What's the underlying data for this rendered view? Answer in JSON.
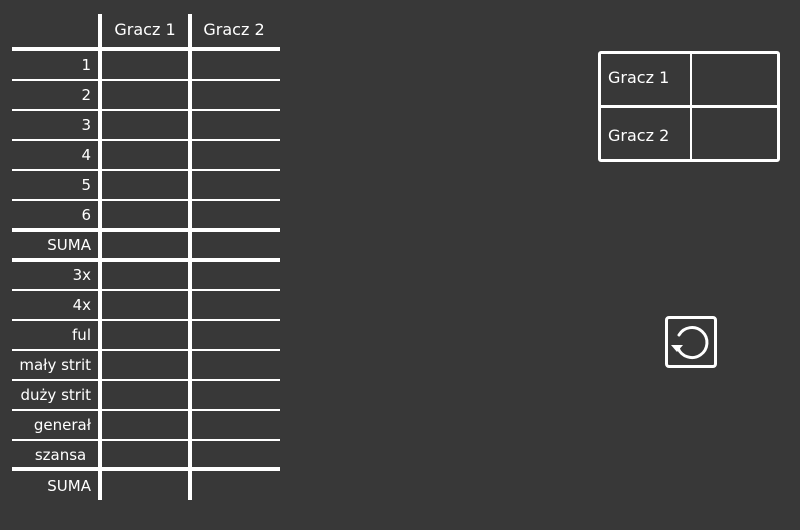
{
  "score_sheet": {
    "players": [
      "Gracz 1",
      "Gracz 2"
    ],
    "rows": [
      {
        "label": "1"
      },
      {
        "label": "2"
      },
      {
        "label": "3"
      },
      {
        "label": "4"
      },
      {
        "label": "5"
      },
      {
        "label": "6"
      },
      {
        "label": "SUMA"
      },
      {
        "label": "3x"
      },
      {
        "label": "4x"
      },
      {
        "label": "ful"
      },
      {
        "label": "mały strit"
      },
      {
        "label": "duży strit"
      },
      {
        "label": "generał"
      },
      {
        "label": "szansa "
      },
      {
        "label": "SUMA"
      }
    ]
  },
  "totals": {
    "players": [
      {
        "name": "Gracz 1",
        "score": ""
      },
      {
        "name": "Gracz 2",
        "score": ""
      }
    ]
  },
  "controls": {
    "reset_icon": "reset-icon"
  }
}
